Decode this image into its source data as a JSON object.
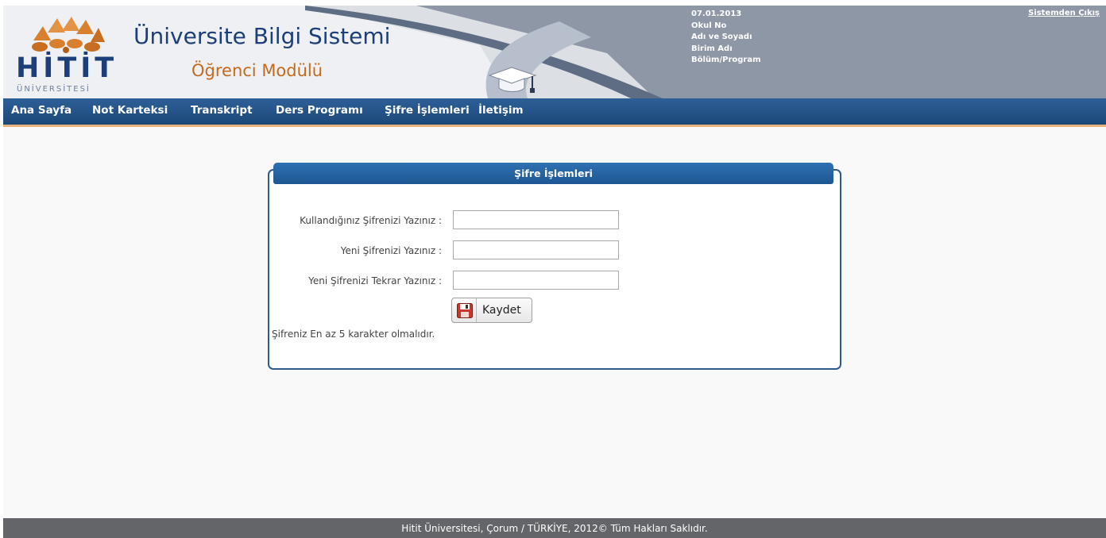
{
  "header": {
    "logo_text": "HİTİT",
    "logo_subtext": "ÜNİVERSİTESİ",
    "title": "Üniversite Bilgi Sistemi",
    "subtitle": "Öğrenci Modülü",
    "logout_label": "Sistemden Çıkış"
  },
  "user_info": {
    "date": "07.01.2013",
    "student_no_label": "Okul No",
    "name_label": "Adı ve Soyadı",
    "unit_label": "Birim Adı",
    "department_label": "Bölüm/Program"
  },
  "nav": {
    "items": [
      {
        "label": "Ana Sayfa"
      },
      {
        "label": "Not Karteksi"
      },
      {
        "label": "Transkript"
      },
      {
        "label": "Ders Programı"
      },
      {
        "label": "Şifre İşlemleri"
      },
      {
        "label": "İletişim"
      }
    ]
  },
  "form": {
    "title": "Şifre İşlemleri",
    "current_password_label": "Kullandığınız Şifrenizi Yazınız :",
    "current_password_value": "",
    "new_password_label": "Yeni Şifrenizi Yazınız :",
    "new_password_value": "",
    "confirm_password_label": "Yeni Şifrenizi Tekrar Yazınız :",
    "confirm_password_value": "",
    "save_label": "Kaydet",
    "hint": "Şifreniz En az 5 karakter olmalıdır."
  },
  "footer": {
    "text": "Hitit Üniversitesi, Çorum / TÜRKİYE, 2012© Tüm Hakları Saklıdır."
  },
  "colors": {
    "nav_background": "#2a5b92",
    "nav_accent": "#e8b27a",
    "panel_header": "#2a66a6",
    "header_title": "#1d3e78",
    "header_subtitle": "#c56a1c",
    "footer_background": "#636569"
  }
}
